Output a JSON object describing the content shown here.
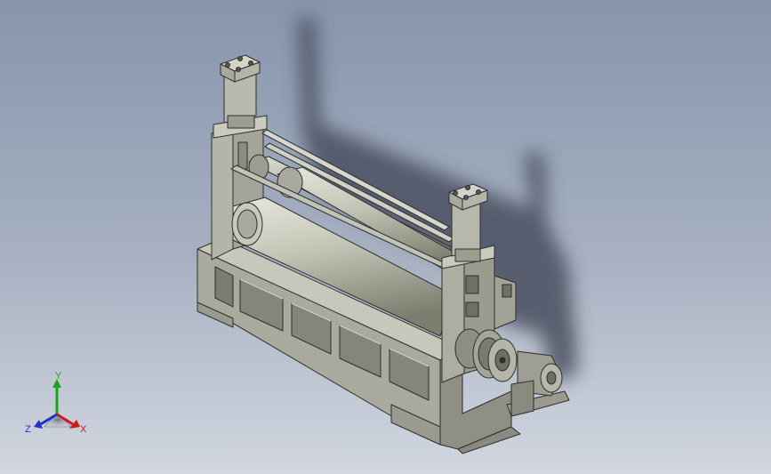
{
  "viewport": {
    "background_top": "#8795ab",
    "background_bottom": "#d2d7e0",
    "model": {
      "subject": "three-roller-plate-bending-machine",
      "body_color": "#b8b8ad",
      "edge_color": "#2f2f2f",
      "shadow_color": "#4a5060"
    },
    "triad": {
      "x_label": "X",
      "y_label": "Y",
      "z_label": "Z",
      "x_color": "#d01818",
      "y_color": "#20a020",
      "z_color": "#2030c8"
    }
  }
}
